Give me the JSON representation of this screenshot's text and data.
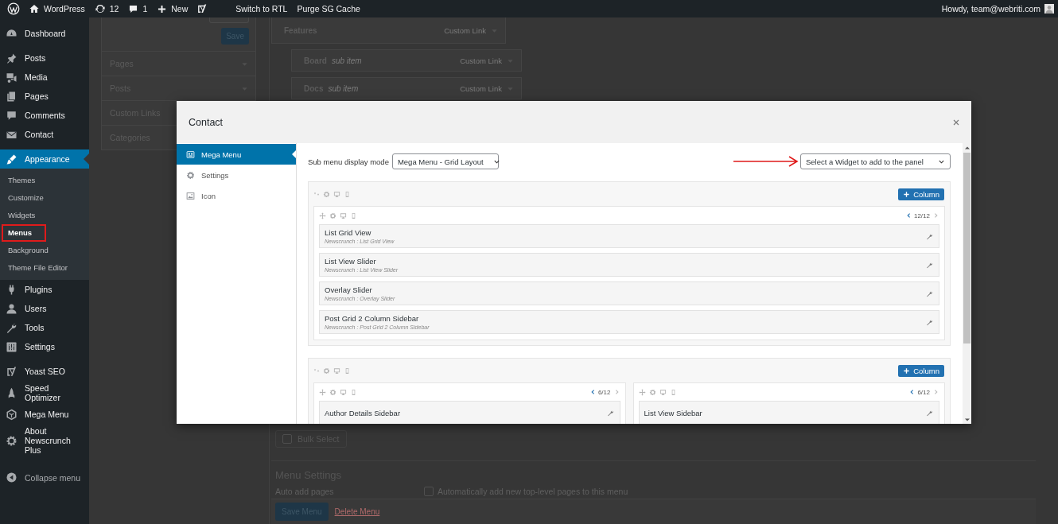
{
  "admin_bar": {
    "items": [
      {
        "kind": "logo"
      },
      {
        "kind": "home",
        "label": "WordPress"
      },
      {
        "kind": "updates",
        "label": "12"
      },
      {
        "kind": "comments",
        "label": "1"
      },
      {
        "kind": "new",
        "label": "New"
      },
      {
        "kind": "yoast"
      },
      {
        "kind": "text",
        "label": "Switch to RTL"
      },
      {
        "kind": "text",
        "label": "Purge SG Cache"
      }
    ],
    "account": "Howdy, team@webriti.com"
  },
  "sidebar": {
    "groups": [
      [
        {
          "label": "Dashboard",
          "kind": "dashboard",
          "selected": false
        }
      ],
      [
        {
          "label": "Posts",
          "kind": "pin",
          "selected": false
        },
        {
          "label": "Media",
          "kind": "media",
          "selected": false
        },
        {
          "label": "Pages",
          "kind": "pages",
          "selected": false
        },
        {
          "label": "Comments",
          "kind": "comment",
          "selected": false
        },
        {
          "label": "Contact",
          "kind": "envelope",
          "selected": false
        }
      ],
      [
        {
          "label": "Appearance",
          "kind": "brush",
          "selected": true,
          "children": [
            {
              "label": "Themes",
              "selected": false,
              "annotated": false
            },
            {
              "label": "Customize",
              "selected": false,
              "annotated": false
            },
            {
              "label": "Widgets",
              "selected": false,
              "annotated": false
            },
            {
              "label": "Menus",
              "selected": true,
              "annotated": true
            },
            {
              "label": "Background",
              "selected": false,
              "annotated": false
            },
            {
              "label": "Theme File Editor",
              "selected": false,
              "annotated": false
            }
          ]
        },
        {
          "label": "Plugins",
          "kind": "plug",
          "selected": false
        },
        {
          "label": "Users",
          "kind": "user",
          "selected": false
        },
        {
          "label": "Tools",
          "kind": "wrench",
          "selected": false
        },
        {
          "label": "Settings",
          "kind": "sliders",
          "selected": false
        }
      ],
      [
        {
          "label": "Yoast SEO",
          "kind": "yoast",
          "selected": false
        },
        {
          "label": "Speed Optimizer",
          "kind": "rocket",
          "selected": false
        },
        {
          "label": "Mega Menu",
          "kind": "hexagon",
          "selected": false
        },
        {
          "label": "About Newscrunch Plus",
          "kind": "gear",
          "selected": false
        }
      ]
    ],
    "collapse": "Collapse menu"
  },
  "menu_editor": {
    "save_button": "Save",
    "sections": [
      "Pages",
      "Posts",
      "Custom Links",
      "Categories"
    ],
    "menu_items": [
      {
        "title": "Features",
        "type": "Custom Link",
        "children": [
          {
            "title": "Board",
            "note": "sub item",
            "type": "Custom Link"
          },
          {
            "title": "Docs",
            "note": "sub item",
            "type": "Custom Link"
          }
        ]
      }
    ],
    "bulk_select": {
      "label": "Bulk Select",
      "checked": false
    },
    "menu_settings": {
      "title": "Menu Settings",
      "auto_add_label": "Auto add pages",
      "auto_add_option": {
        "label": "Automatically add new top-level pages to this menu",
        "checked": false
      }
    },
    "save_menu": "Save Menu",
    "delete_menu": "Delete Menu"
  },
  "modal": {
    "title": "Contact",
    "tabs": [
      {
        "label": "Mega Menu",
        "kind": "grid",
        "selected": true
      },
      {
        "label": "Settings",
        "kind": "gear",
        "selected": false
      },
      {
        "label": "Icon",
        "kind": "image",
        "selected": false
      }
    ],
    "display_mode": {
      "label": "Sub menu display mode",
      "value": "Mega Menu - Grid Layout"
    },
    "widget_select": {
      "text": "Select a Widget to add to the panel"
    },
    "rows": [
      {
        "add_column": "Column",
        "columns": [
          {
            "span": "12/12",
            "widgets": [
              {
                "title": "List Grid View",
                "subtitle": "Newscrunch : List Grid View"
              },
              {
                "title": "List View Slider",
                "subtitle": "Newscrunch : List View Slider"
              },
              {
                "title": "Overlay Slider",
                "subtitle": "Newscrunch : Overlay Slider"
              },
              {
                "title": "Post Grid 2 Column Sidebar",
                "subtitle": "Newscrunch : Post Grid 2 Column Sidebar"
              }
            ]
          }
        ]
      },
      {
        "add_column": "Column",
        "columns": [
          {
            "span": "6/12",
            "widgets": [
              {
                "title": "Author Details Sidebar"
              }
            ]
          },
          {
            "span": "6/12",
            "widgets": [
              {
                "title": "List View Sidebar"
              }
            ]
          }
        ]
      }
    ]
  }
}
